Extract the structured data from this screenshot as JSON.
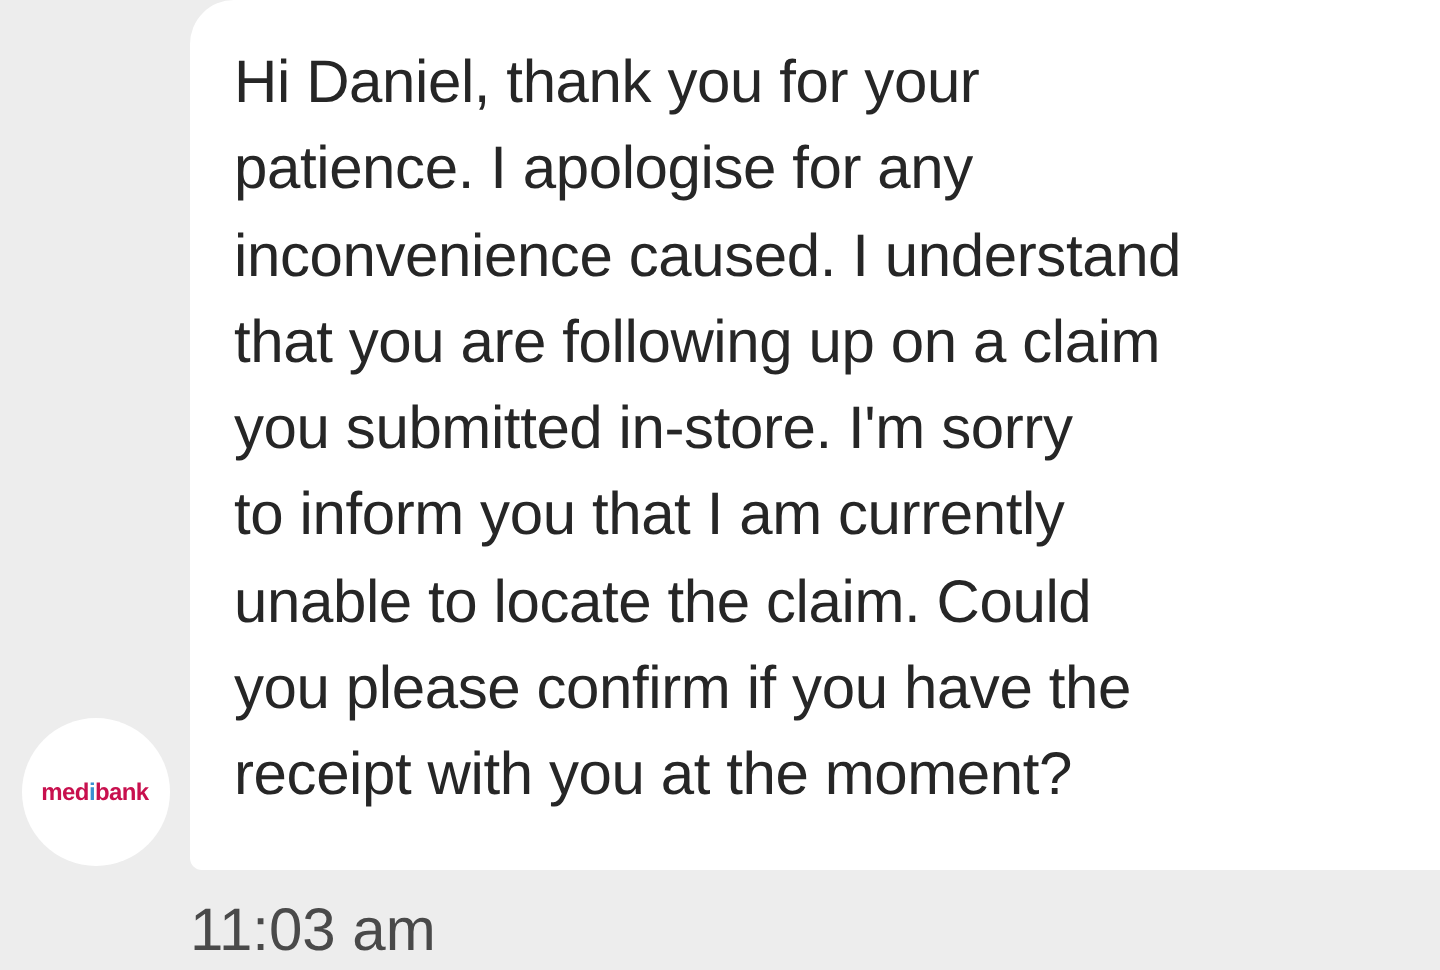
{
  "message": {
    "lines": [
      "Hi Daniel, thank you for your",
      "patience. I apologise for any",
      "inconvenience caused. I understand",
      "that you are following up on a claim",
      "you submitted in-store. I'm sorry",
      "to inform you that I am currently",
      "unable to locate the claim. Could",
      "you please confirm if you have the",
      "receipt with you at the moment?"
    ],
    "time": "11:03 am"
  },
  "avatar": {
    "logo_parts": [
      "med",
      "i",
      "bank"
    ]
  }
}
